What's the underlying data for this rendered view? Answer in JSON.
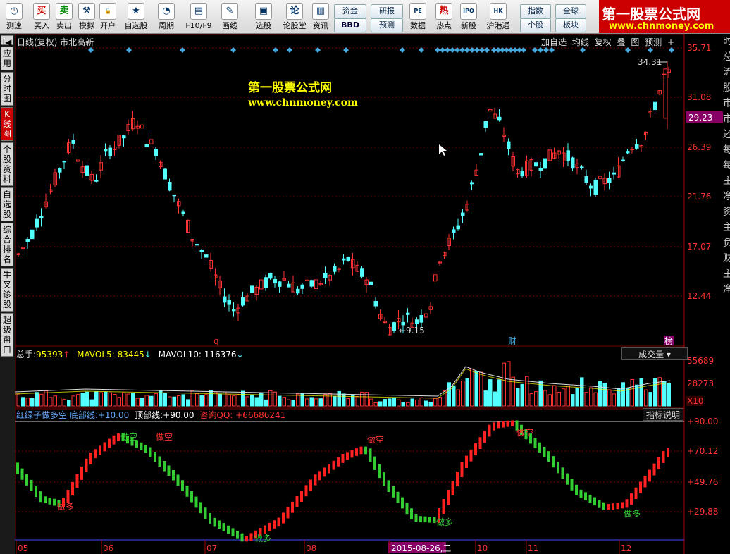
{
  "toolbar": {
    "buttons": [
      {
        "name": "huice",
        "label": "测速",
        "icon": "◷"
      },
      {
        "name": "buy",
        "label": "买入",
        "icon": "买"
      },
      {
        "name": "sell",
        "label": "卖出",
        "icon": "卖"
      },
      {
        "name": "sim",
        "label": "模拟",
        "icon": "⚒"
      },
      {
        "name": "open",
        "label": "开户",
        "icon": "🔒"
      },
      {
        "name": "watch",
        "label": "自选股",
        "icon": "★"
      },
      {
        "name": "period",
        "label": "周期",
        "icon": "◔"
      },
      {
        "name": "f10",
        "label": "F10/F9",
        "icon": "▤"
      },
      {
        "name": "draw",
        "label": "画线",
        "icon": "✎"
      },
      {
        "name": "pick",
        "label": "选股",
        "icon": "▣"
      },
      {
        "name": "forum",
        "label": "论股堂",
        "icon": "论"
      },
      {
        "name": "info",
        "label": "资讯",
        "icon": "▥"
      },
      {
        "name": "data",
        "label": "数据",
        "icon": "PE"
      },
      {
        "name": "hot",
        "label": "热点",
        "icon": "热"
      },
      {
        "name": "ipo",
        "label": "新股",
        "icon": "IPO"
      },
      {
        "name": "hk",
        "label": "沪港通",
        "icon": "HK"
      }
    ],
    "small_buttons": [
      "资金",
      "研报",
      "BBD",
      "预测",
      "指数",
      "全球",
      "个股",
      "板块"
    ]
  },
  "banner": {
    "title": "第一股票公式网",
    "url": "www.chnmoney.com"
  },
  "side_tabs": [
    "应用",
    "分时图",
    "K线图",
    "个股资料",
    "自选股",
    "综合排名",
    "牛叉诊股",
    "超级盘口"
  ],
  "side_tab_top": "K",
  "main": {
    "title": "日线(复权)  市北高新",
    "top_right": [
      "加自选",
      "均线",
      "复权",
      "叠",
      "图",
      "预测",
      "+"
    ],
    "watermark_title": "第一股票公式网",
    "watermark_url": "www.chnmoney.com",
    "price_labels": [
      "35.71",
      "31.08",
      "26.39",
      "21.76",
      "17.07",
      "12.44"
    ],
    "current_price": "29.23",
    "high_label": "34.31",
    "low_label": "9.15",
    "markers": [
      "q",
      "财",
      "榜"
    ]
  },
  "volume": {
    "zongshou_label": "总手:",
    "zongshou": "95393",
    "mavol5_label": "MAVOL5:",
    "mavol5": "83445",
    "mavol10_label": "MAVOL10:",
    "mavol10": "116376",
    "selector": "成交量",
    "axis": [
      "55689",
      "28273",
      "X10"
    ]
  },
  "indicator": {
    "name": "红绿子做多空 底部线:",
    "bottom": "+10.00",
    "top_label": "顶部线:",
    "top": "+90.00",
    "contact": "咨询QQ: +66686241",
    "help": "指标说明",
    "axis": [
      "+90.00",
      "+70.12",
      "+49.76",
      "+29.88"
    ],
    "signals": [
      "做多",
      "做空",
      "做空",
      "做多",
      "做空",
      "做多",
      "做空",
      "做多"
    ]
  },
  "xaxis": [
    "05",
    "06",
    "07",
    "08",
    "2015-08-26,三",
    "10",
    "11",
    "12"
  ],
  "right_partial": [
    "时",
    "总",
    "流",
    "股",
    "市",
    "市",
    "还",
    "每",
    "每",
    "主",
    "净",
    "资",
    "主",
    "负",
    "财",
    "主",
    "净"
  ],
  "colors": {
    "up": "#ff3232",
    "down": "#54ffff",
    "grid": "#7a0000",
    "buy": "#ff2020",
    "sell": "#33cc33"
  }
}
